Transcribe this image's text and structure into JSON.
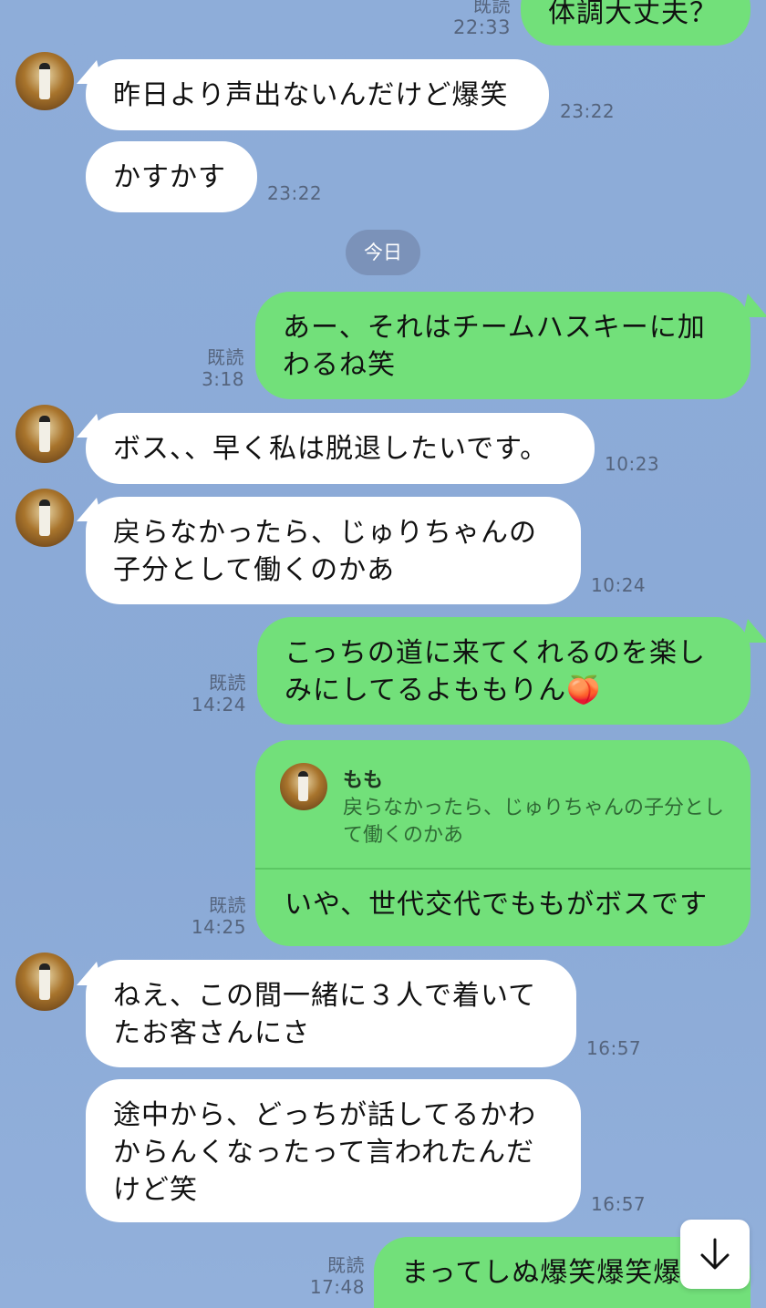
{
  "read_label": "既読",
  "date_separator": "今日",
  "messages": [
    {
      "side": "out",
      "text": "体調大丈夫？",
      "time": "22:33"
    },
    {
      "side": "in",
      "text": "昨日より声出ないんだけど爆笑",
      "time": "23:22"
    },
    {
      "side": "in",
      "text": "かすかす",
      "time": "23:22"
    },
    {
      "side": "out",
      "text": "あー、それはチームハスキーに加わるね笑",
      "time": "3:18"
    },
    {
      "side": "in",
      "text": "ボス、、早く私は脱退したいです。",
      "time": "10:23"
    },
    {
      "side": "in",
      "text": "戻らなかったら、じゅりちゃんの子分として働くのかあ",
      "time": "10:24"
    },
    {
      "side": "out",
      "text": "こっちの道に来てくれるのを楽しみにしてるよももりん🍑",
      "time": "14:24"
    },
    {
      "side": "out",
      "reply_to": {
        "name": "もも",
        "text": "戻らなかったら、じゅりちゃんの子分として働くのかあ"
      },
      "text": "いや、世代交代でももがボスです",
      "time": "14:25"
    },
    {
      "side": "in",
      "text": "ねえ、この間一緒に３人で着いてたお客さんにさ",
      "time": "16:57"
    },
    {
      "side": "in",
      "text": "途中から、どっちが話してるかわからんくなったって言われたんだけど笑",
      "time": "16:57"
    },
    {
      "side": "out",
      "text": "まってしぬ爆笑爆笑爆",
      "time": "17:48"
    }
  ],
  "icons": {
    "avatar": "avatar-image",
    "scroll": "arrow-down-icon"
  },
  "colors": {
    "background": "#8eadd9",
    "outgoing": "#72e07a",
    "incoming": "#ffffff",
    "meta": "#55647d"
  }
}
